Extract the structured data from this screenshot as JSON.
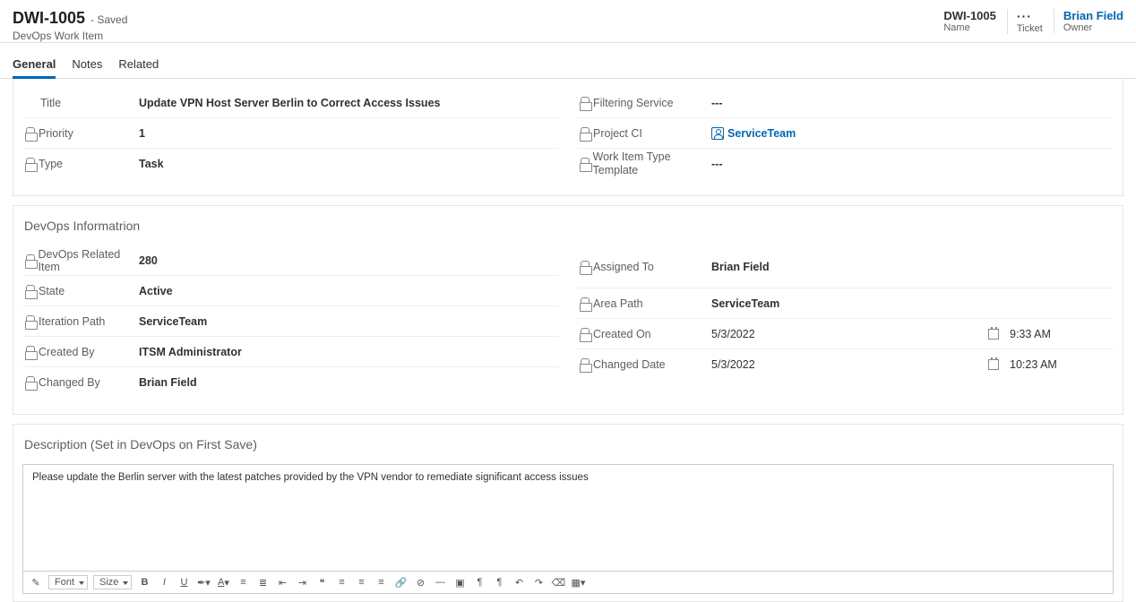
{
  "header": {
    "id": "DWI-1005",
    "saved": "- Saved",
    "subtitle": "DevOps Work Item",
    "right": {
      "name_value": "DWI-1005",
      "name_label": "Name",
      "ticket_value": "···",
      "ticket_label": "Ticket",
      "owner_value": "Brian Field",
      "owner_label": "Owner"
    }
  },
  "tabs": {
    "general": "General",
    "notes": "Notes",
    "related": "Related"
  },
  "top_section": {
    "left": {
      "title_label": "Title",
      "title_value": "Update VPN Host Server Berlin to Correct Access Issues",
      "priority_label": "Priority",
      "priority_value": "1",
      "type_label": "Type",
      "type_value": "Task"
    },
    "right": {
      "filtering_label": "Filtering Service",
      "filtering_value": "---",
      "project_label": "Project CI",
      "project_value": "ServiceTeam",
      "template_label": "Work Item Type Template",
      "template_value": "---"
    }
  },
  "devops": {
    "title": "DevOps Informatrion",
    "left": {
      "related_label": "DevOps Related Item",
      "related_value": "280",
      "state_label": "State",
      "state_value": "Active",
      "iteration_label": "Iteration Path",
      "iteration_value": "ServiceTeam",
      "createdby_label": "Created By",
      "createdby_value": "ITSM Administrator",
      "changedby_label": "Changed By",
      "changedby_value": "Brian Field"
    },
    "right": {
      "assigned_label": "Assigned To",
      "assigned_value": "Brian Field",
      "area_label": "Area Path",
      "area_value": "ServiceTeam",
      "createdon_label": "Created On",
      "createdon_date": "5/3/2022",
      "createdon_time": "9:33 AM",
      "changeddate_label": "Changed Date",
      "changeddate_date": "5/3/2022",
      "changeddate_time": "10:23 AM"
    }
  },
  "description": {
    "title": "Description (Set in DevOps on First Save)",
    "text": "Please update the Berlin server with the latest patches provided by the VPN vendor to remediate significant access issues"
  },
  "toolbar": {
    "font": "Font",
    "size": "Size"
  }
}
